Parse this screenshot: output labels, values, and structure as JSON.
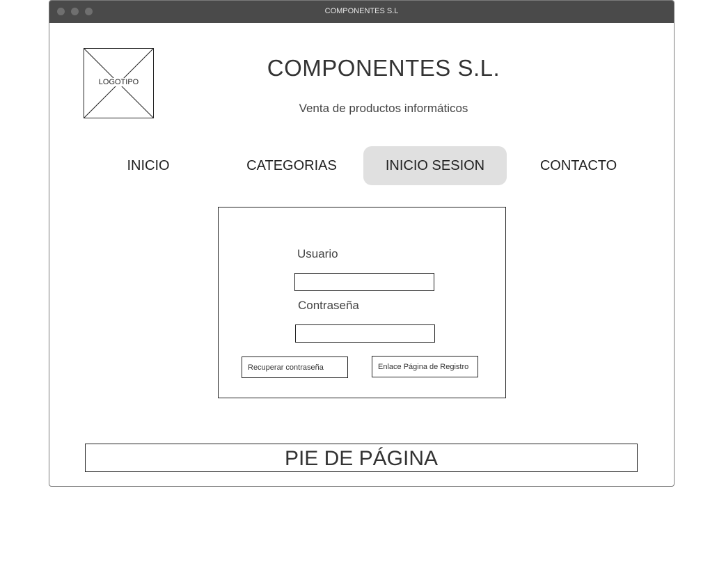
{
  "window": {
    "title": "COMPONENTES S.L"
  },
  "header": {
    "logo_label": "LOGOTIPO",
    "title": "COMPONENTES S.L.",
    "subtitle": "Venta de productos informáticos"
  },
  "nav": {
    "items": [
      {
        "label": "INICIO",
        "active": false
      },
      {
        "label": "CATEGORIAS",
        "active": false
      },
      {
        "label": "INICIO SESION",
        "active": true
      },
      {
        "label": "CONTACTO",
        "active": false
      }
    ]
  },
  "login": {
    "username_label": "Usuario",
    "username_value": "",
    "password_label": "Contraseña",
    "password_value": "",
    "recover_button": "Recuperar contraseña",
    "register_link": "Enlace Página de Registro"
  },
  "footer": {
    "text": "PIE DE PÁGINA"
  },
  "colors": {
    "active_nav_bg": "#e0e0e0",
    "titlebar_bg": "#4a4a4a"
  }
}
